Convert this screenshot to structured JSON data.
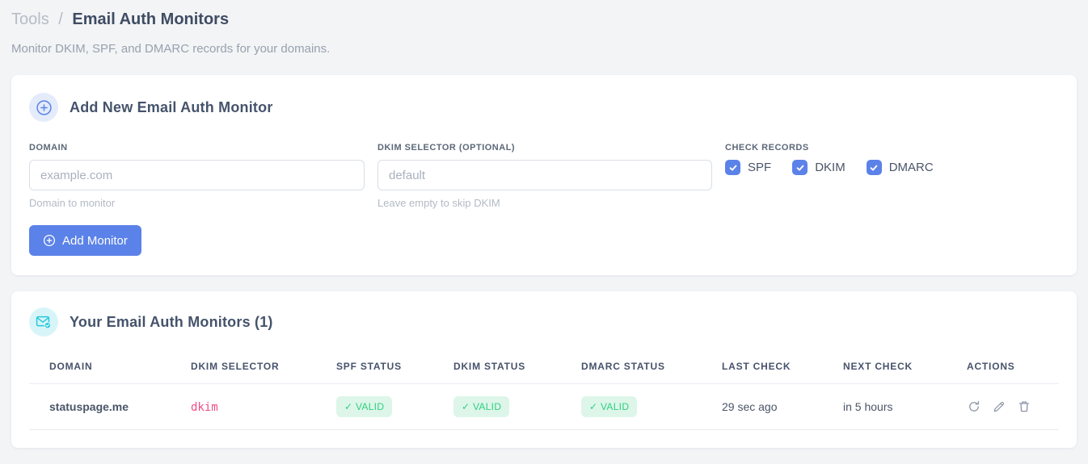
{
  "page": {
    "breadcrumb": {
      "parent": "Tools",
      "separator": "/",
      "current": "Email Auth Monitors"
    },
    "subtitle": "Monitor DKIM, SPF, and DMARC records for your domains."
  },
  "add_monitor_card": {
    "title": "Add New Email Auth Monitor",
    "header_icon": "plus-circle-icon",
    "fields": {
      "domain": {
        "label": "DOMAIN",
        "placeholder": "example.com",
        "value": "",
        "helper": "Domain to monitor"
      },
      "dkim_selector": {
        "label": "DKIM SELECTOR (OPTIONAL)",
        "placeholder": "default",
        "value": "",
        "helper": "Leave empty to skip DKIM"
      }
    },
    "check_records": {
      "label": "CHECK RECORDS",
      "options": [
        {
          "label": "SPF",
          "checked": true
        },
        {
          "label": "DKIM",
          "checked": true
        },
        {
          "label": "DMARC",
          "checked": true
        }
      ]
    },
    "submit_label": "Add Monitor"
  },
  "monitors_card": {
    "title": "Your Email Auth Monitors (1)",
    "header_icon": "envelope-check-icon",
    "table": {
      "headers": [
        "DOMAIN",
        "DKIM SELECTOR",
        "SPF STATUS",
        "DKIM STATUS",
        "DMARC STATUS",
        "LAST CHECK",
        "NEXT CHECK",
        "ACTIONS"
      ],
      "rows": [
        {
          "domain": "statuspage.me",
          "dkim_selector": "dkim",
          "spf_status": "✓ VALID",
          "dkim_status": "✓ VALID",
          "dmarc_status": "✓ VALID",
          "last_check": "29 sec ago",
          "next_check": "in 5 hours",
          "actions": [
            "refresh-icon",
            "edit-pencil-icon",
            "trash-icon"
          ]
        }
      ]
    }
  },
  "colors": {
    "accent_blue": "#5b82e8",
    "accent_cyan": "#27c8dc",
    "valid_green_text": "#2fcf80",
    "valid_green_bg": "#ddf6e9",
    "code_pink": "#ee4d86",
    "page_background": "#f2f4f6"
  }
}
